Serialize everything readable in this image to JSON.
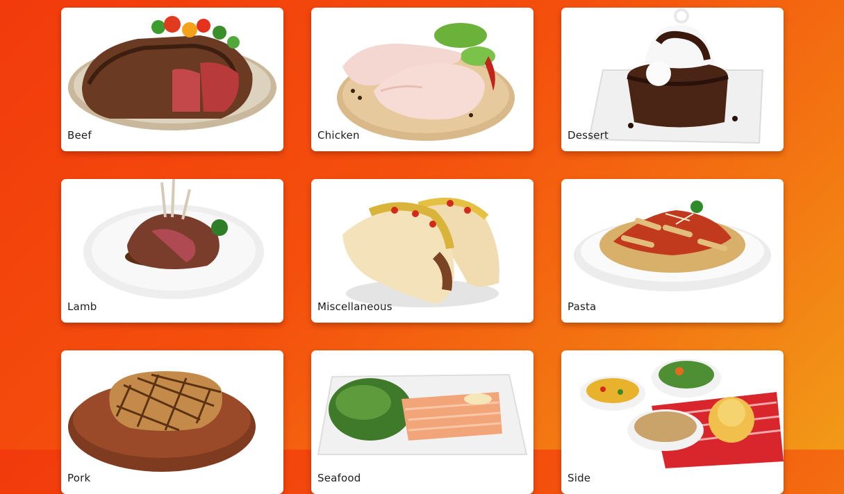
{
  "categories": [
    {
      "label": "Beef",
      "image": "grilled-steak-plate"
    },
    {
      "label": "Chicken",
      "image": "raw-chicken-legs-board"
    },
    {
      "label": "Dessert",
      "image": "chocolate-lava-cake"
    },
    {
      "label": "Lamb",
      "image": "lamb-chops-plate"
    },
    {
      "label": "Miscellaneous",
      "image": "tacos"
    },
    {
      "label": "Pasta",
      "image": "penne-bolognese"
    },
    {
      "label": "Pork",
      "image": "pork-chop-board"
    },
    {
      "label": "Seafood",
      "image": "salmon-salad-plate"
    },
    {
      "label": "Side",
      "image": "side-dishes-bowls"
    }
  ]
}
